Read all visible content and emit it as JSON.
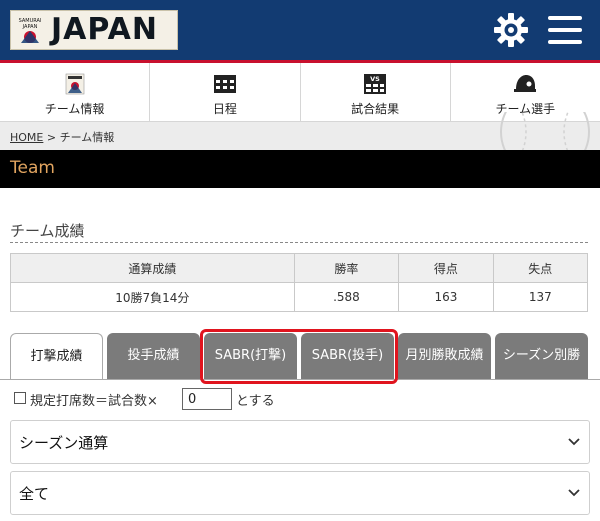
{
  "header": {
    "logo_badge_text": "SAMURAI JAPAN",
    "logo_text": "JAPAN",
    "menu_icon": "hamburger-icon",
    "settings_icon": "gear-icon"
  },
  "nav": {
    "items": [
      {
        "label": "チーム情報",
        "icon": "team-badge-icon"
      },
      {
        "label": "日程",
        "icon": "calendar-icon"
      },
      {
        "label": "試合結果",
        "icon": "vs-scoreboard-icon"
      },
      {
        "label": "チーム選手",
        "icon": "helmet-icon"
      }
    ]
  },
  "breadcrumb": {
    "home": "HOME",
    "separator": ">",
    "current": "チーム情報"
  },
  "band": {
    "title": "Team"
  },
  "team_record": {
    "title": "チーム成績",
    "headers": [
      "通算成績",
      "勝率",
      "得点",
      "失点"
    ],
    "values": [
      "10勝7負14分",
      ".588",
      "163",
      "137"
    ]
  },
  "tabs": {
    "items": [
      {
        "label": "打撃成績",
        "active": true
      },
      {
        "label": "投手成績",
        "active": false
      },
      {
        "label": "SABR(打撃)",
        "active": false
      },
      {
        "label": "SABR(投手)",
        "active": false
      },
      {
        "label": "月別勝敗成績",
        "active": false
      },
      {
        "label": "シーズン別勝",
        "active": false
      }
    ]
  },
  "qualification": {
    "checked": false,
    "prefix": "規定打席数＝試合数×",
    "value": "0",
    "suffix": "とする"
  },
  "filters": {
    "season_select": "シーズン通算",
    "scope_select": "全て"
  },
  "colors": {
    "header_bg": "#123b72",
    "accent_red": "#c8102e",
    "band_bg": "#000000",
    "band_text": "#e2a560",
    "tab_inactive": "#7b7b7b",
    "highlight_box": "#e0141e"
  }
}
